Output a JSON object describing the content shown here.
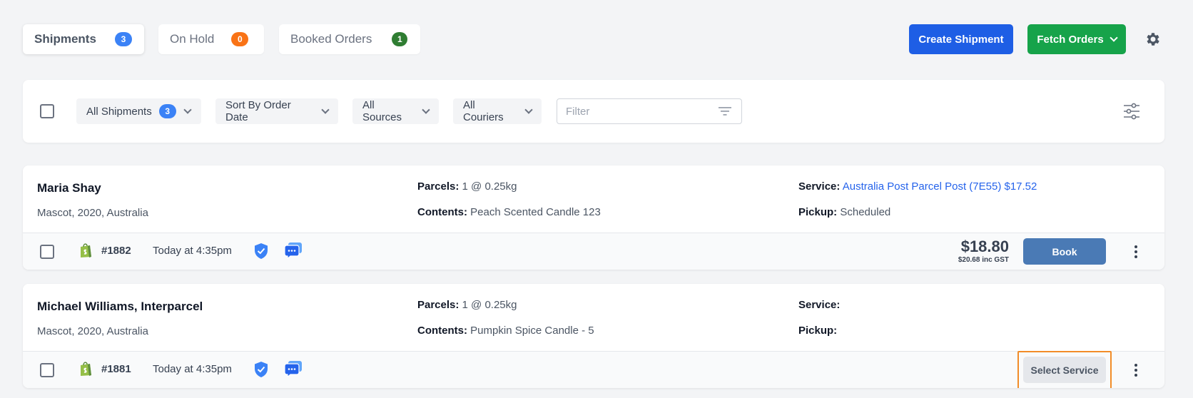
{
  "tabs": [
    {
      "label": "Shipments",
      "count": "3",
      "color": "#3b82f6"
    },
    {
      "label": "On Hold",
      "count": "0",
      "color": "#f97316"
    },
    {
      "label": "Booked Orders",
      "count": "1",
      "color": "#2f7d32"
    }
  ],
  "header": {
    "create_label": "Create Shipment",
    "fetch_label": "Fetch Orders",
    "create_color": "#1e5ee5",
    "fetch_color": "#16a34a"
  },
  "filters": {
    "all_shipments": "All Shipments",
    "all_shipments_count": "3",
    "sort": "Sort By Order Date",
    "sources": "All Sources",
    "couriers": "All Couriers",
    "filter_placeholder": "Filter"
  },
  "labels": {
    "parcels": "Parcels:",
    "contents": "Contents:",
    "service": "Service:",
    "pickup": "Pickup:"
  },
  "shipments": [
    {
      "name": "Maria Shay",
      "address": "Mascot, 2020, Australia",
      "parcels": "1 @ 0.25kg",
      "contents": "Peach Scented Candle 123",
      "service": "Australia Post Parcel Post (7E55) $17.52",
      "pickup": "Scheduled",
      "order_no": "#1882",
      "time": "Today at 4:35pm",
      "price": "$18.80",
      "price_inc": "$20.68 inc GST",
      "action": "Book"
    },
    {
      "name": "Michael Williams, Interparcel",
      "address": "Mascot, 2020, Australia",
      "parcels": "1 @ 0.25kg",
      "contents": "Pumpkin Spice Candle - 5",
      "service": "",
      "pickup": "",
      "order_no": "#1881",
      "time": "Today at 4:35pm",
      "action": "Select Service"
    }
  ],
  "icons": {
    "settings": "gear-icon",
    "columns": "sliders-icon",
    "filter": "filter-icon",
    "shopify": "shopify-bag-icon",
    "protection": "shield-check-icon",
    "messages": "chat-bubbles-icon"
  },
  "colors": {
    "book_button": "#4a7ab5",
    "select_service_highlight": "#f28c28",
    "link": "#2563eb"
  }
}
